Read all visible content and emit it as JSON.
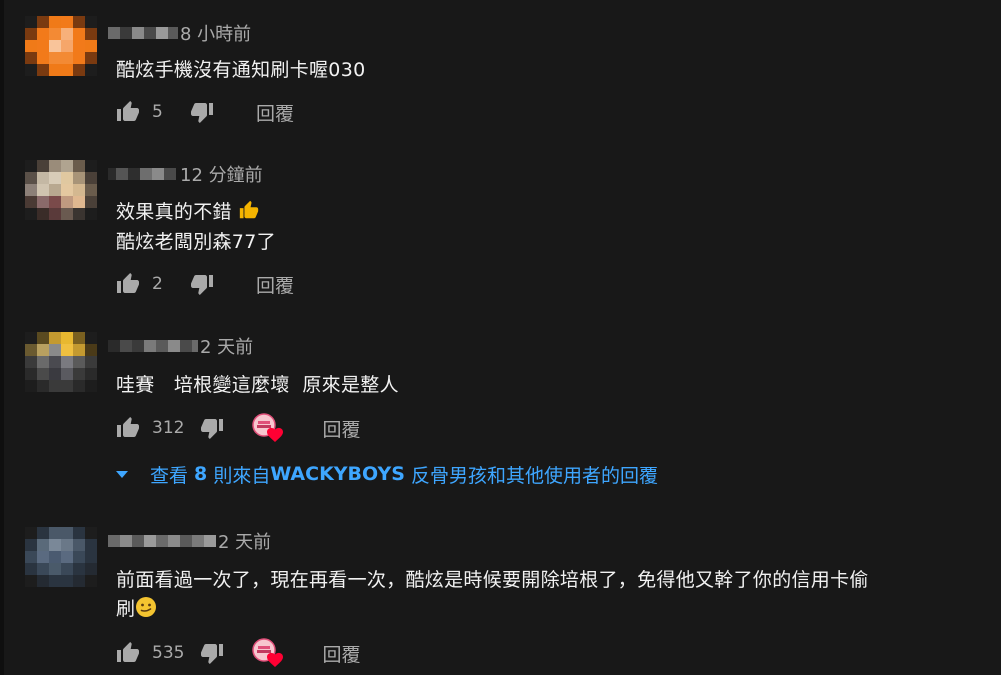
{
  "comments": [
    {
      "time": "8 小時前",
      "lines": [
        "酷炫手機沒有通知刷卡喔030"
      ],
      "likes": "5",
      "reply_label": "回覆"
    },
    {
      "time": "12 分鐘前",
      "lines": [
        "效果真的不錯",
        "酷炫老闆別森77了"
      ],
      "likes": "2",
      "reply_label": "回覆",
      "emoji": "thumbs-up-emoji"
    },
    {
      "time": "2 天前",
      "lines": [
        "哇賽　培根變這麼壞  原來是整人"
      ],
      "likes": "312",
      "reply_label": "回覆",
      "creator_hearted": true,
      "replies": {
        "prefix": "查看 ",
        "count": "8",
        "mid": " 則來自",
        "channel": "WACKYBOYS",
        "suffix": " 反骨男孩和其他使用者的回覆"
      }
    },
    {
      "time": "2 天前",
      "lines": [
        "前面看過一次了，現在再看一次，酷炫是時候要開除培根了，免得他又幹了你的信用卡偷",
        "刷"
      ],
      "likes": "535",
      "reply_label": "回覆",
      "creator_hearted": true,
      "emoji": "smirk-emoji"
    }
  ],
  "colors": {
    "background": "#181818",
    "text": "#f1f1f1",
    "secondary": "#aaaaaa",
    "link": "#3ea6ff",
    "heart": "#ff0033"
  }
}
